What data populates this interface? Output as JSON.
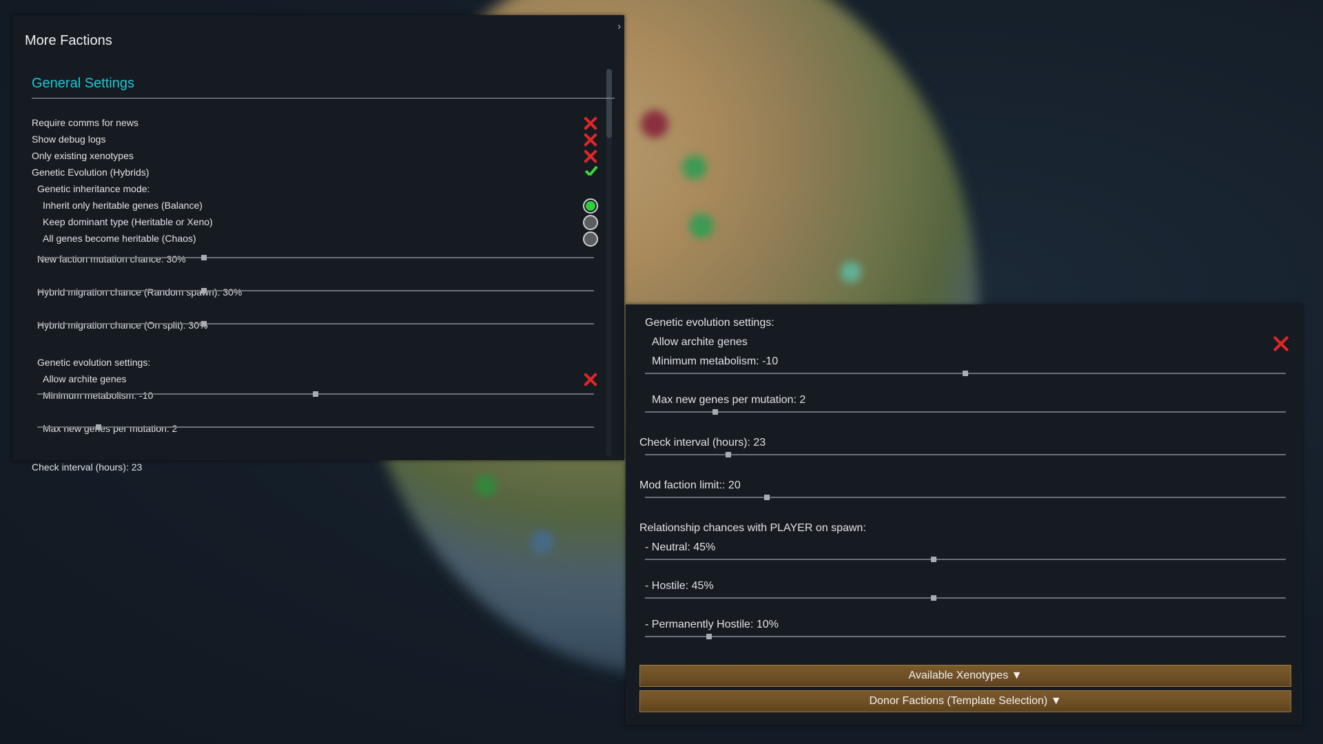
{
  "window": {
    "title": "More Factions",
    "close_glyph": "›"
  },
  "general": {
    "section_title": "General Settings",
    "toggles": [
      {
        "label": "Require comms for news",
        "state": "off"
      },
      {
        "label": "Show debug logs",
        "state": "off"
      },
      {
        "label": "Only existing xenotypes",
        "state": "off"
      },
      {
        "label": "Genetic Evolution (Hybrids)",
        "state": "on"
      }
    ],
    "inheritance_mode_label": "Genetic inheritance mode:",
    "inheritance_options": [
      {
        "label": "Inherit only heritable genes (Balance)",
        "selected": true
      },
      {
        "label": "Keep dominant type (Heritable or Xeno)",
        "selected": false
      },
      {
        "label": "All genes become heritable (Chaos)",
        "selected": false
      }
    ],
    "sliders": [
      {
        "label": "New faction mutation chance: 30%",
        "value": 0.3
      },
      {
        "label": "Hybrid migration chance (Random spawn): 30%",
        "value": 0.3
      },
      {
        "label": "Hybrid migration chance (On split): 30%",
        "value": 0.3
      }
    ],
    "evolution_label": "Genetic evolution settings:",
    "allow_archite_label": "Allow archite genes",
    "allow_archite_state": "off",
    "min_metabolism": {
      "label": "Minimum metabolism: -10",
      "value": 0.5
    },
    "max_genes": {
      "label": "Max new genes per mutation: 2",
      "value": 0.11
    },
    "check_interval_label": "Check interval (hours): 23"
  },
  "detail": {
    "evolution_label": "Genetic evolution settings:",
    "allow_archite_label": "Allow archite genes",
    "allow_archite_state": "off",
    "min_metabolism": {
      "label": "Minimum metabolism: -10",
      "value": 0.5
    },
    "max_genes": {
      "label": "Max new genes per mutation: 2",
      "value": 0.11
    },
    "check_interval": {
      "label": "Check interval (hours): 23",
      "value": 0.13
    },
    "faction_limit": {
      "label": "Mod faction limit:: 20",
      "value": 0.19
    },
    "relationship_label": "Relationship chances with PLAYER on spawn:",
    "relationships": [
      {
        "label": "- Neutral: 45%",
        "value": 0.45
      },
      {
        "label": "- Hostile: 45%",
        "value": 0.45
      },
      {
        "label": "- Permanently Hostile: 10%",
        "value": 0.1
      }
    ],
    "buttons": {
      "xenotypes": "Available Xenotypes ▼",
      "donors": "Donor Factions (Template Selection) ▼"
    }
  },
  "colors": {
    "accent": "#1fc6d6",
    "off": "#e0262a",
    "on": "#3dd43d",
    "button": "#6d4f25"
  }
}
